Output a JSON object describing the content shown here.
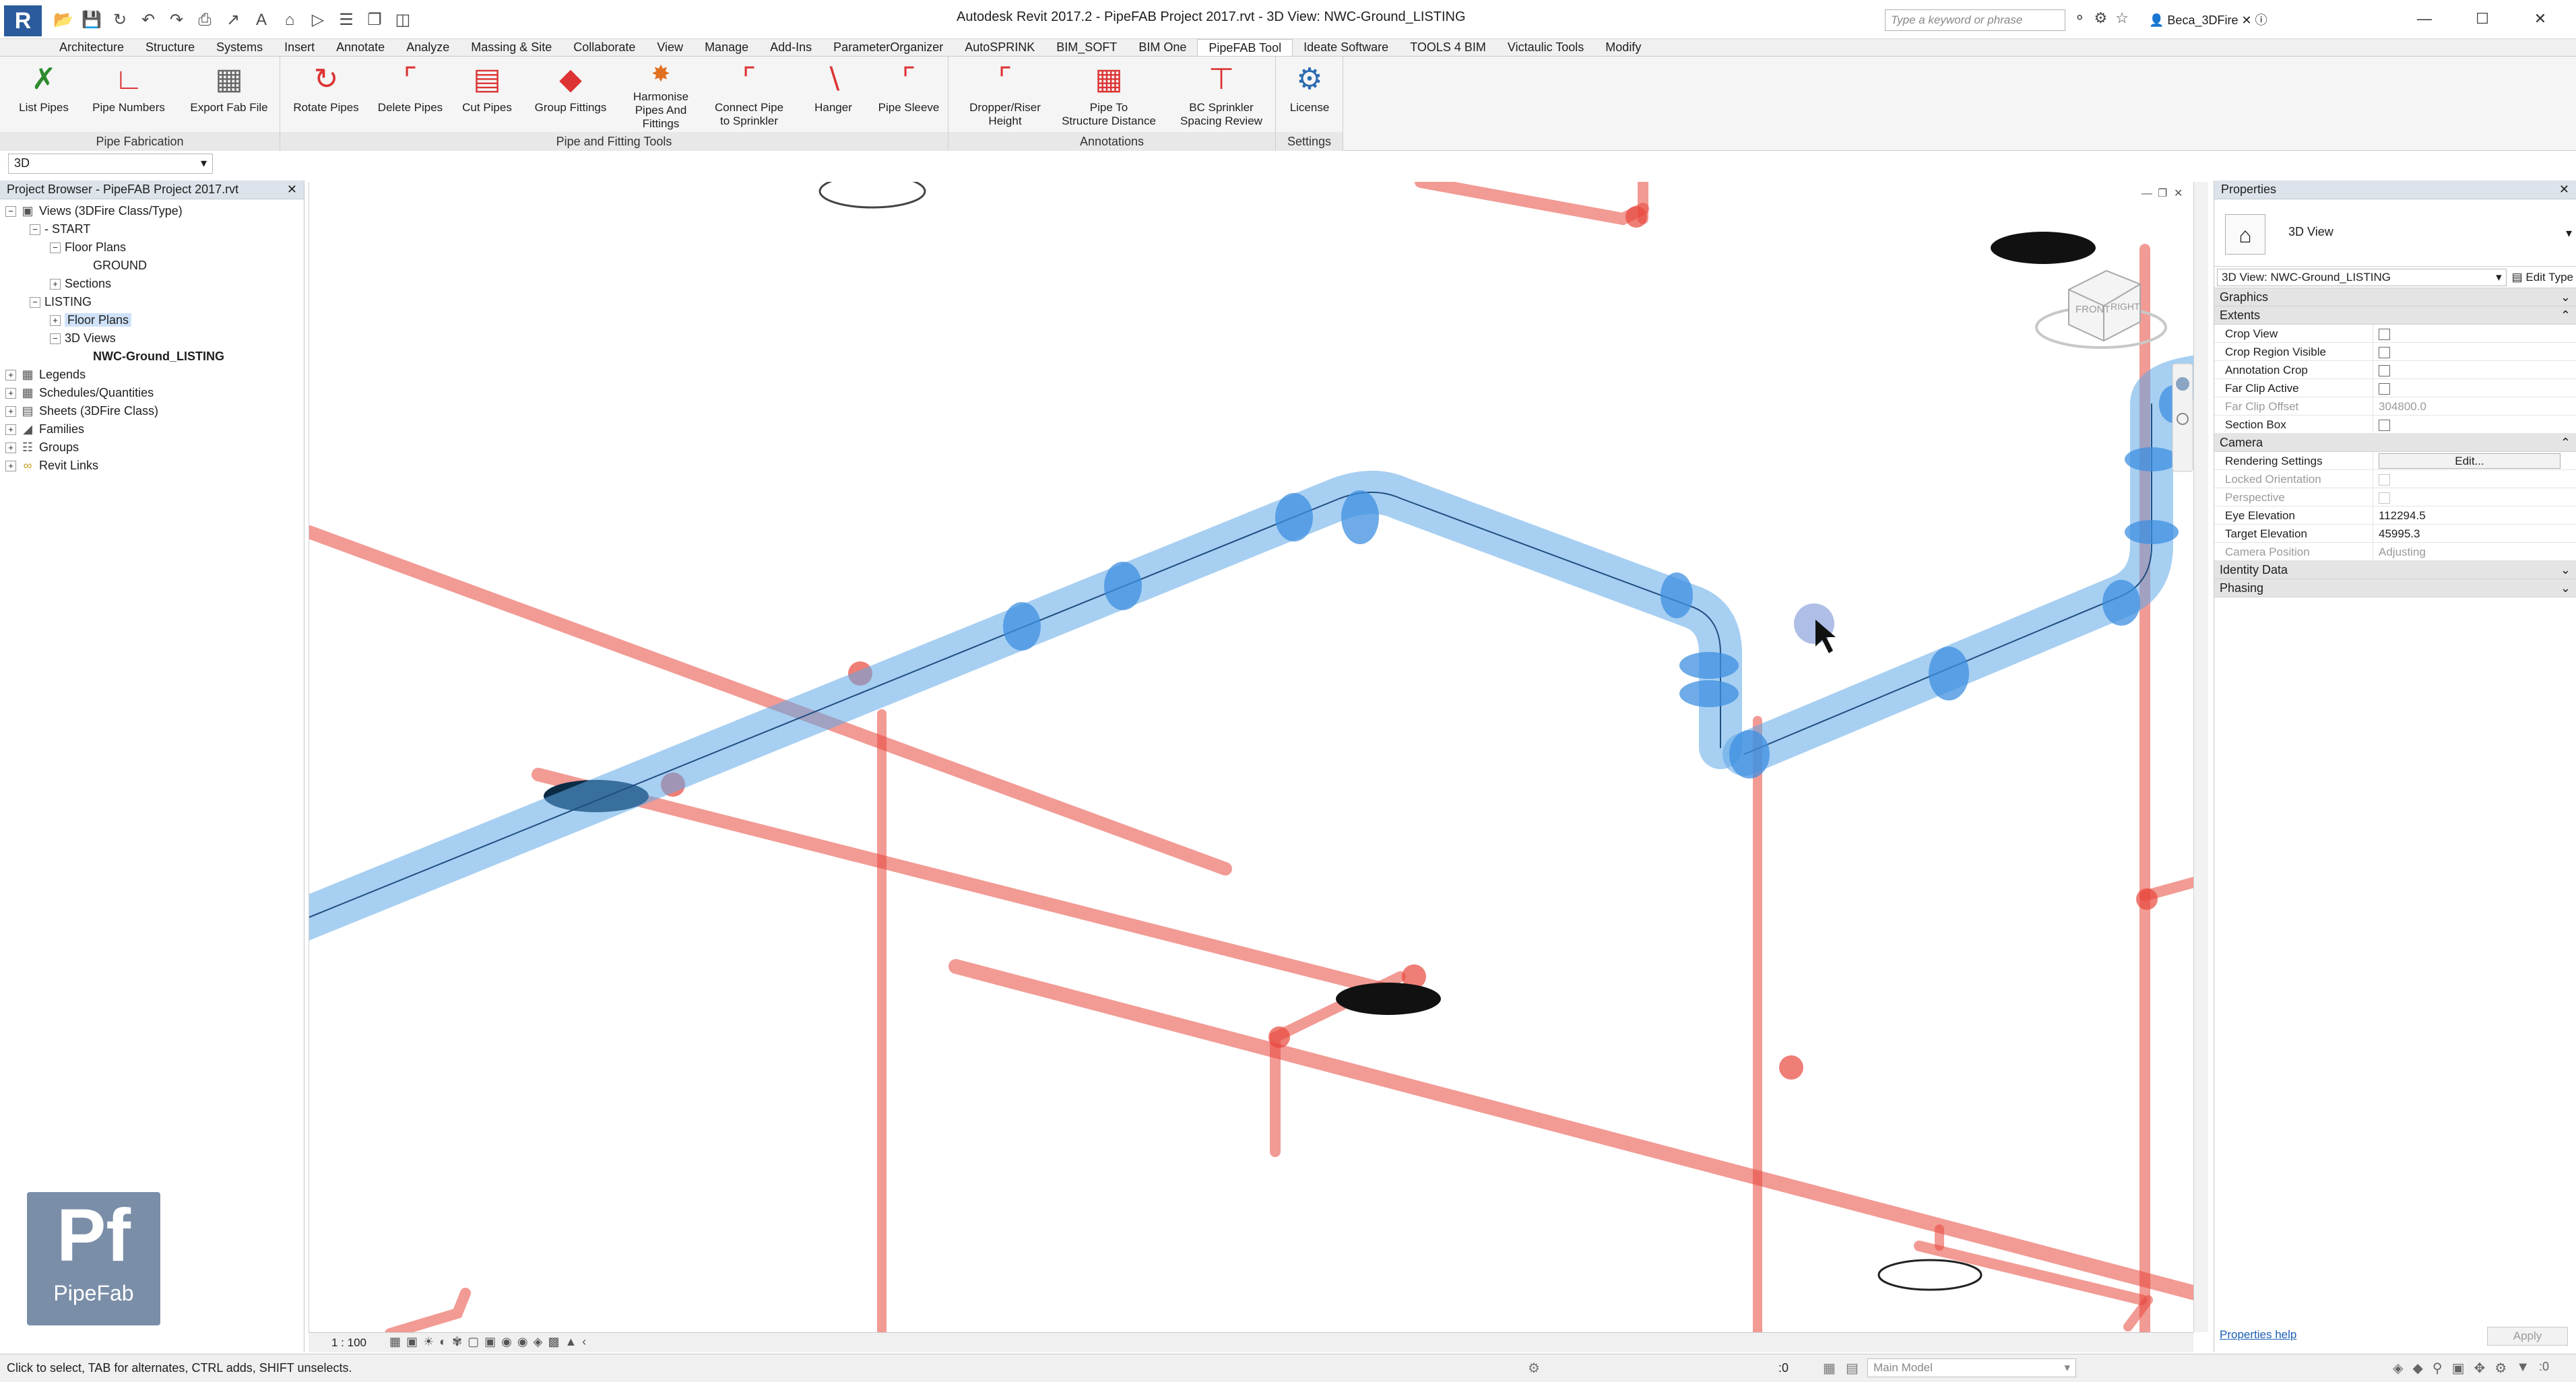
{
  "titlebar": {
    "app_logo": "R",
    "title": "Autodesk Revit 2017.2 -     PipeFAB Project 2017.rvt - 3D View: NWC-Ground_LISTING",
    "search_placeholder": "Type a keyword or phrase",
    "user": "Beca_3DFire",
    "qat_icons": [
      "open-icon",
      "save-icon",
      "sync-icon",
      "undo-icon",
      "redo-icon",
      "print-icon",
      "measure-icon",
      "text-icon",
      "3d-icon",
      "section-icon",
      "thin-lines-icon",
      "close-hidden-icon",
      "switch-windows-icon"
    ]
  },
  "ribbon_tabs": [
    {
      "label": "Architecture"
    },
    {
      "label": "Structure"
    },
    {
      "label": "Systems"
    },
    {
      "label": "Insert"
    },
    {
      "label": "Annotate"
    },
    {
      "label": "Analyze"
    },
    {
      "label": "Massing & Site"
    },
    {
      "label": "Collaborate"
    },
    {
      "label": "View"
    },
    {
      "label": "Manage"
    },
    {
      "label": "Add-Ins"
    },
    {
      "label": "ParameterOrganizer"
    },
    {
      "label": "AutoSPRINK"
    },
    {
      "label": "BIM_SOFT"
    },
    {
      "label": "BIM One"
    },
    {
      "label": "PipeFAB Tool"
    },
    {
      "label": "Ideate Software"
    },
    {
      "label": "TOOLS 4 BIM"
    },
    {
      "label": "Victaulic Tools"
    },
    {
      "label": "Modify"
    }
  ],
  "ribbon": {
    "panels": {
      "fabrication": "Pipe Fabrication",
      "tools": "Pipe and Fitting Tools",
      "annotations": "Annotations",
      "settings": "Settings"
    },
    "buttons": {
      "list_pipes": "List Pipes",
      "pipe_numbers": "Pipe Numbers",
      "export_fab": "Export Fab File",
      "rotate_pipes": "Rotate Pipes",
      "delete_pipes": "Delete Pipes",
      "cut_pipes": "Cut Pipes",
      "group_fittings": "Group Fittings",
      "harmonise_1": "Harmonise",
      "harmonise_2": "Pipes And",
      "harmonise_3": "Fittings",
      "connect_1": "Connect Pipe",
      "connect_2": "to Sprinkler",
      "hanger": "Hanger",
      "pipe_sleeve": "Pipe Sleeve",
      "dropper_1": "Dropper/Riser",
      "dropper_2": "Height",
      "structure_1": "Pipe To",
      "structure_2": "Structure Distance",
      "bc_1": "BC Sprinkler",
      "bc_2": "Spacing Review",
      "license": "License"
    }
  },
  "view_selector": "3D",
  "project_browser": {
    "title": "Project Browser - PipeFAB Project 2017.rvt",
    "items": [
      {
        "label": "Views (3DFire Class/Type)",
        "toggle": "−"
      },
      {
        "label": "- START",
        "toggle": "−"
      },
      {
        "label": "Floor Plans",
        "toggle": "−"
      },
      {
        "label": "GROUND",
        "toggle": ""
      },
      {
        "label": "Sections",
        "toggle": "+"
      },
      {
        "label": "LISTING",
        "toggle": "−"
      },
      {
        "label": "Floor Plans",
        "toggle": "+"
      },
      {
        "label": "3D Views",
        "toggle": "−"
      },
      {
        "label": "NWC-Ground_LISTING",
        "toggle": ""
      },
      {
        "label": "Legends",
        "toggle": "+"
      },
      {
        "label": "Schedules/Quantities",
        "toggle": "+"
      },
      {
        "label": "Sheets (3DFire Class)",
        "toggle": "+"
      },
      {
        "label": "Families",
        "toggle": "+"
      },
      {
        "label": "Groups",
        "toggle": "+"
      },
      {
        "label": "Revit Links",
        "toggle": "+"
      }
    ]
  },
  "logo": {
    "glyph": "Pf",
    "name": "PipeFab"
  },
  "viewport": {
    "scale": "1 : 100",
    "viewcube_front": "FRONT",
    "viewcube_right": "RIGHT"
  },
  "properties": {
    "title": "Properties",
    "type_name": "3D View",
    "filter": "3D View: NWC-Ground_LISTING",
    "edit_type": "Edit Type",
    "groups": {
      "graphics": "Graphics",
      "extents": "Extents",
      "camera": "Camera",
      "identity": "Identity Data",
      "phasing": "Phasing"
    },
    "rows": {
      "crop_view": "Crop View",
      "crop_region_visible": "Crop Region Visible",
      "annotation_crop": "Annotation Crop",
      "far_clip_active": "Far Clip Active",
      "far_clip_offset": "Far Clip Offset",
      "far_clip_offset_val": "304800.0",
      "section_box": "Section Box",
      "rendering_settings": "Rendering Settings",
      "rendering_edit": "Edit...",
      "locked_orientation": "Locked Orientation",
      "perspective": "Perspective",
      "eye_elevation": "Eye Elevation",
      "eye_elevation_val": "112294.5",
      "target_elevation": "Target Elevation",
      "target_elevation_val": "45995.3",
      "camera_position": "Camera Position",
      "camera_position_val": "Adjusting"
    },
    "help": "Properties help",
    "apply": "Apply"
  },
  "statusbar": {
    "text": "Click to select, TAB for alternates, CTRL adds, SHIFT unselects.",
    "model": "Main Model",
    "workset_count": ":0",
    "filter_count": ":0"
  },
  "colors": {
    "blue_pipe": "#5ea8e8",
    "red_pipe": "#e8473c",
    "accent": "#2b5b9c"
  }
}
